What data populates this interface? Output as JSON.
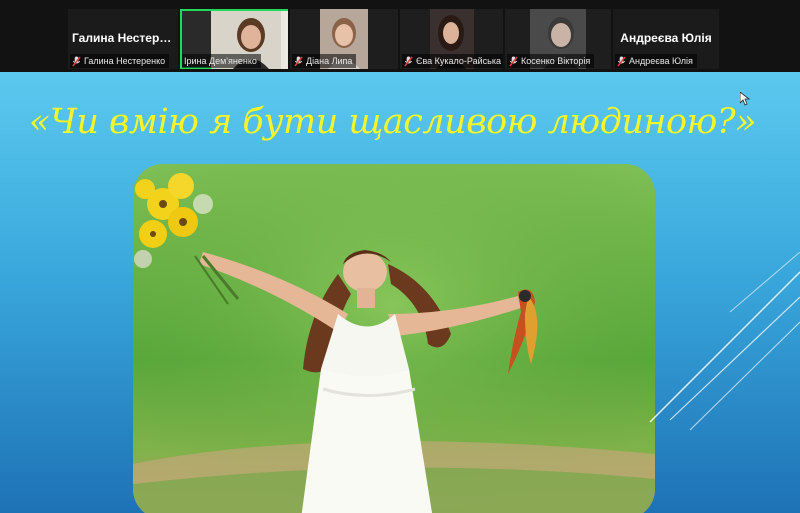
{
  "participants": [
    {
      "id": "p1",
      "tile_name": "Галина  Нестере...",
      "label": "Галина Нестеренко",
      "muted": true,
      "video": false,
      "active": false
    },
    {
      "id": "p2",
      "label": "Ірина Дем'яненко",
      "muted": false,
      "video": true,
      "active": true
    },
    {
      "id": "p3",
      "label": "Діана Липа",
      "muted": true,
      "video": true,
      "active": false
    },
    {
      "id": "p4",
      "label": "Єва Кукало-Райська",
      "muted": true,
      "video": true,
      "active": false
    },
    {
      "id": "p5",
      "label": "Косенко Вікторія",
      "muted": true,
      "video": true,
      "active": false
    },
    {
      "id": "p6",
      "tile_name": "Андреєва Юлія",
      "label": "Андреєва Юлія",
      "muted": true,
      "video": false,
      "active": false
    }
  ],
  "slide": {
    "title": "«Чи вмію я бути щасливою людиною?»",
    "title_color": "#f5f52a",
    "background_top": "#5bc9ee",
    "background_bottom": "#1d72b6",
    "image_subject": "woman in white dress with sunflowers in green field"
  },
  "colors": {
    "active_speaker": "#23d959",
    "muted_mic": "#e03b3b",
    "strip_background": "#121212"
  },
  "icons": {
    "muted": "microphone-muted-icon",
    "cursor": "mouse-pointer-icon"
  }
}
